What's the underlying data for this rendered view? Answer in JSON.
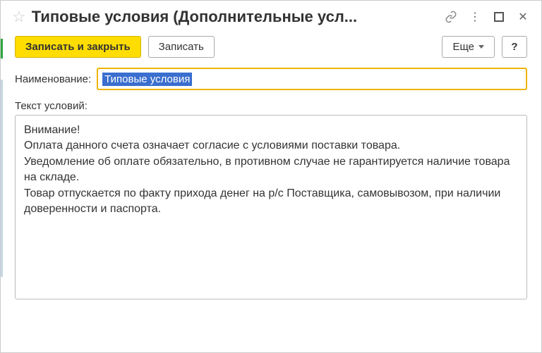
{
  "titlebar": {
    "title": "Типовые условия (Дополнительные усл..."
  },
  "toolbar": {
    "save_close_label": "Записать и закрыть",
    "save_label": "Записать",
    "more_label": "Еще",
    "help_label": "?"
  },
  "form": {
    "name_label": "Наименование:",
    "name_value": "Типовые условия",
    "conditions_label": "Текст условий:",
    "conditions_value": "Внимание!\nОплата данного счета означает согласие с условиями поставки товара.\nУведомление об оплате обязательно, в противном случае не гарантируется наличие товара на складе.\nТовар отпускается по факту прихода денег на р/с Поставщика, самовывозом, при наличии доверенности и паспорта."
  }
}
